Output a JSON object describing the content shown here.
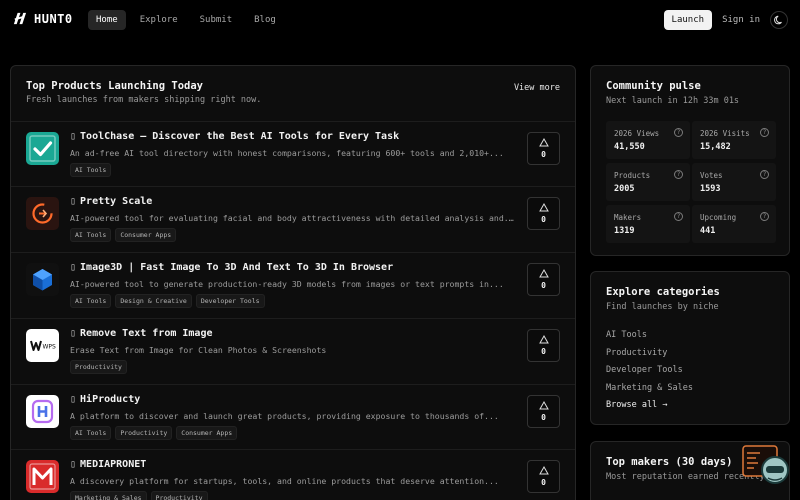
{
  "header": {
    "logo_text": "HUNT0",
    "nav": [
      "Home",
      "Explore",
      "Submit",
      "Blog"
    ],
    "launch_label": "Launch",
    "signin_label": "Sign in"
  },
  "main": {
    "title": "Top Products Launching Today",
    "subtitle": "Fresh launches from makers shipping right now.",
    "view_more": "View more",
    "products": [
      {
        "name": "ToolChase – Discover the Best AI Tools for Every Task",
        "description": "An ad-free AI tool directory with honest comparisons, featuring 600+ tools and 2,010+...",
        "tags": [
          "AI Tools"
        ],
        "votes": "0",
        "icon": "toolchase-logo"
      },
      {
        "name": "Pretty Scale",
        "description": "AI-powered tool for evaluating facial and body attractiveness with detailed analysis and...",
        "tags": [
          "AI Tools",
          "Consumer Apps"
        ],
        "votes": "0",
        "icon": "pretty-scale-logo"
      },
      {
        "name": "Image3D | Fast Image To 3D And Text To 3D In Browser",
        "description": "AI-powered tool to generate production-ready 3D models from images or text prompts in...",
        "tags": [
          "AI Tools",
          "Design & Creative",
          "Developer Tools"
        ],
        "votes": "0",
        "icon": "image3d-logo"
      },
      {
        "name": "Remove Text from Image",
        "description": "Erase Text from Image for Clean Photos & Screenshots",
        "tags": [
          "Productivity"
        ],
        "votes": "0",
        "icon": "wps-logo"
      },
      {
        "name": "HiProducty",
        "description": "A platform to discover and launch great products, providing exposure to thousands of...",
        "tags": [
          "AI Tools",
          "Productivity",
          "Consumer Apps"
        ],
        "votes": "0",
        "icon": "hiproducty-logo"
      },
      {
        "name": "MEDIAPRONET",
        "description": "A discovery platform for startups, tools, and online products that deserve attention...",
        "tags": [
          "Marketing & Sales",
          "Productivity"
        ],
        "votes": "0",
        "icon": "mediapronet-logo"
      }
    ]
  },
  "pulse": {
    "title": "Community pulse",
    "next_launch": "Next launch in 12h 33m 01s",
    "stats": [
      {
        "label": "2026 Views",
        "value": "41,550"
      },
      {
        "label": "2026 Visits",
        "value": "15,482"
      },
      {
        "label": "Products",
        "value": "2005"
      },
      {
        "label": "Votes",
        "value": "1593"
      },
      {
        "label": "Makers",
        "value": "1319"
      },
      {
        "label": "Upcoming",
        "value": "441"
      }
    ]
  },
  "explore": {
    "title": "Explore categories",
    "subtitle": "Find launches by niche",
    "categories": [
      "AI Tools",
      "Productivity",
      "Developer Tools",
      "Marketing & Sales"
    ],
    "browse_all": "Browse all →"
  },
  "makers": {
    "title": "Top makers (30 days)",
    "subtitle": "Most reputation earned recently"
  },
  "colors": {
    "background": "#000000",
    "panel": "#0d0d0d",
    "border": "#262626",
    "accent_launch": "#f2f2f2"
  }
}
